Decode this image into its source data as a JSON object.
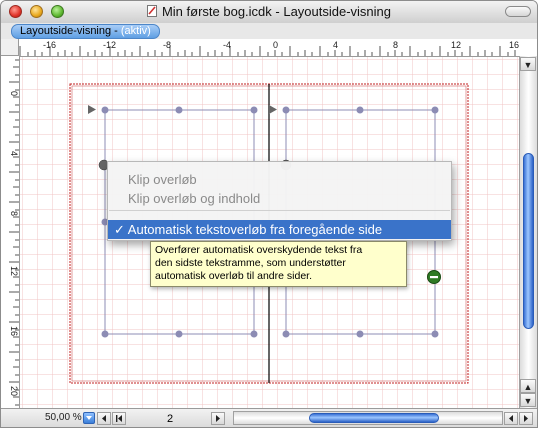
{
  "window": {
    "title": "Min første bog.icdk - Layoutside-visning"
  },
  "tab": {
    "label": "Layoutside-visning - ",
    "status": "(aktiv)"
  },
  "ruler": {
    "h_labels": [
      "-16",
      "-12",
      "-8",
      "-4",
      "0",
      "4",
      "8",
      "12",
      "16"
    ],
    "v_labels": [
      "0",
      "4",
      "8",
      "12",
      "16",
      "20"
    ]
  },
  "context_menu": {
    "items": [
      {
        "label": "Klip overløb"
      },
      {
        "label": "Klip overløb og indhold"
      },
      {
        "label": "✓ Automatisk tekstoverløb fra foregående side"
      }
    ]
  },
  "tooltip": {
    "lines": [
      "Overfører automatisk overskydende tekst fra",
      "den sidste tekstramme, som understøtter",
      "automatisk overløb til andre sider."
    ]
  },
  "statusbar": {
    "zoom": "50,00 %",
    "page": "2"
  },
  "colors": {
    "selection": "#3a73c9",
    "page_border": "#c02020",
    "grid": "#f2c4c4",
    "frame_handle": "#8c8cb4",
    "scroll_thumb": "#3a72d6"
  }
}
